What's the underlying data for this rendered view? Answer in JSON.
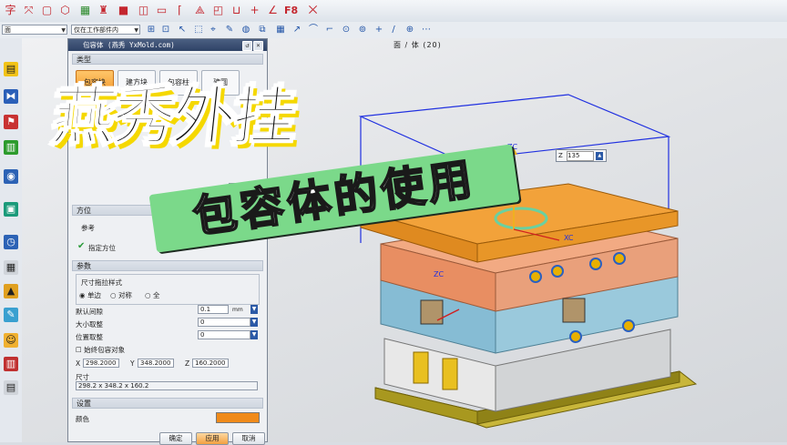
{
  "toolbar": {
    "f8_label": "F8",
    "icons": [
      "text-icon",
      "snap-icon",
      "box-icon",
      "cube-icon",
      "grid-icon",
      "bucket-icon",
      "view-icon",
      "box2-icon",
      "box3-icon",
      "box4-icon",
      "angle-icon",
      "box5-icon",
      "cyl-icon",
      "box6-icon",
      "bracket-icon",
      "plus-icon",
      "angle2-icon",
      "f8-icon",
      "xbar-icon"
    ]
  },
  "toolbar2": {
    "filter_value": "面",
    "scope_value": "仅在工作部件内"
  },
  "view": {
    "status": "面 / 体 (20)"
  },
  "dialog": {
    "title": "包容体 (燕秀 YxMold.com)",
    "sections": {
      "type": "类型",
      "orientation": "方位",
      "params": "参数",
      "settings": "设置"
    },
    "type_buttons": [
      "包容块",
      "建方块",
      "包容柱",
      "建圆"
    ],
    "ref_label": "参考",
    "specify_orientation": "指定方位",
    "size_style_label": "尺寸拖拉样式",
    "radio_single": "单边",
    "radio_symmetric": "对称",
    "radio_third": "全",
    "default_gap_label": "默认间隙",
    "default_gap_value": "0.1",
    "default_gap_unit": "mm",
    "size_adjust_label": "大小取整",
    "size_adjust_value": "0",
    "pos_adjust_label": "位置取整",
    "pos_adjust_value": "0",
    "always_body_label": "始终包容对象",
    "x_label": "X",
    "x_value": "298.2000",
    "y_label": "Y",
    "y_value": "348.2000",
    "z_label": "Z",
    "z_value": "160.2000",
    "size_label": "尺寸",
    "size_value": "298.2 x 348.2 x 160.2",
    "color_label": "颜色",
    "color_value": "#f08a1a",
    "ok": "确定",
    "apply": "应用",
    "cancel": "取消"
  },
  "overlay": {
    "title": "燕秀外挂",
    "subtitle": "包容体的使用"
  },
  "model": {
    "z_tag": "Z",
    "z_value": "135",
    "axis_zc": "ZC",
    "axis_xc": "XC",
    "axis_yc": "YC"
  }
}
